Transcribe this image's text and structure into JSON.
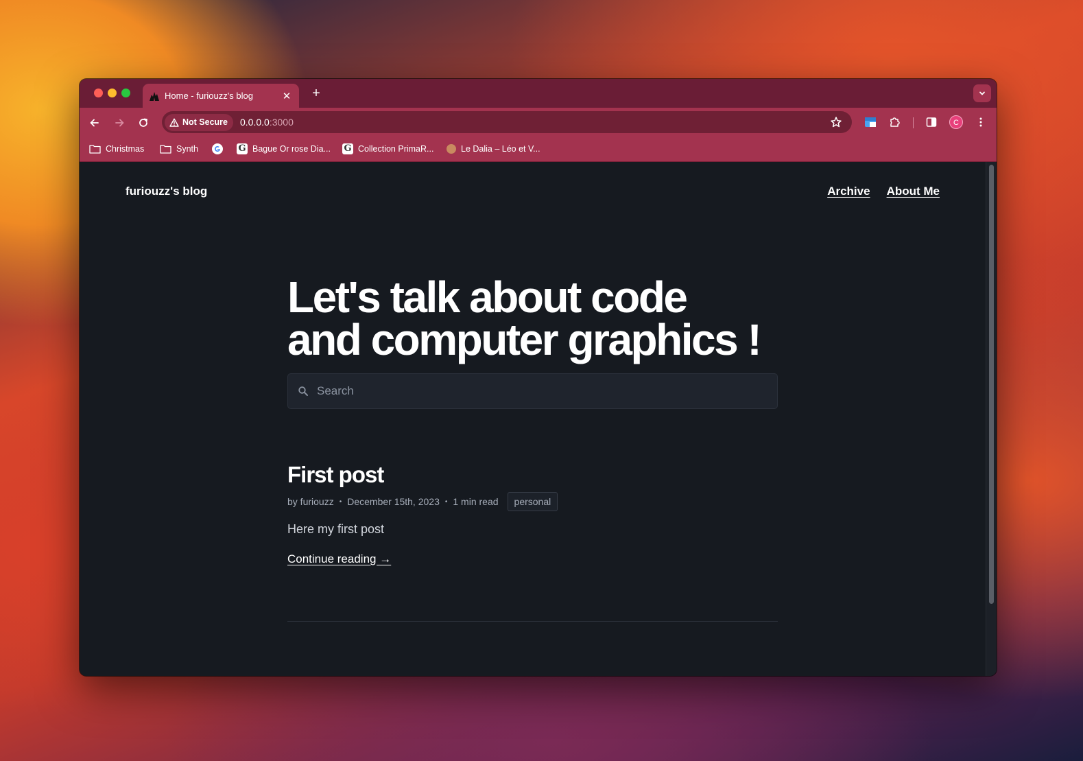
{
  "browser": {
    "tab_title": "Home - furiouzz's blog",
    "tab_close": "✕",
    "new_tab": "+",
    "security_label": "Not Secure",
    "url_host": "0.0.0.0",
    "url_port": ":3000",
    "profile_initial": "C",
    "bookmarks": [
      {
        "label": "Christmas",
        "icon": "folder-icon"
      },
      {
        "label": "Synth",
        "icon": "folder-icon"
      },
      {
        "label": "",
        "icon": "google-icon"
      },
      {
        "label": "Bague Or rose Dia...",
        "icon": "g-favicon"
      },
      {
        "label": "Collection PrimaR...",
        "icon": "g-favicon"
      },
      {
        "label": "Le Dalia – Léo et V...",
        "icon": "dot-favicon"
      }
    ]
  },
  "site": {
    "title": "furiouzz's blog",
    "nav": {
      "archive": "Archive",
      "about": "About Me"
    },
    "hero_line1": "Let's talk about code",
    "hero_line2": "and computer graphics !",
    "search_placeholder": "Search"
  },
  "post": {
    "title": "First post",
    "author": "by furiouzz",
    "date": "December 15th, 2023",
    "read_time": "1 min read",
    "tag": "personal",
    "excerpt": "Here my first post",
    "continue": "Continue reading →",
    "bullet": "•"
  },
  "colors": {
    "tab_strip": "#6a1d36",
    "toolbar": "#a3334f",
    "page_bg": "#161a20"
  }
}
